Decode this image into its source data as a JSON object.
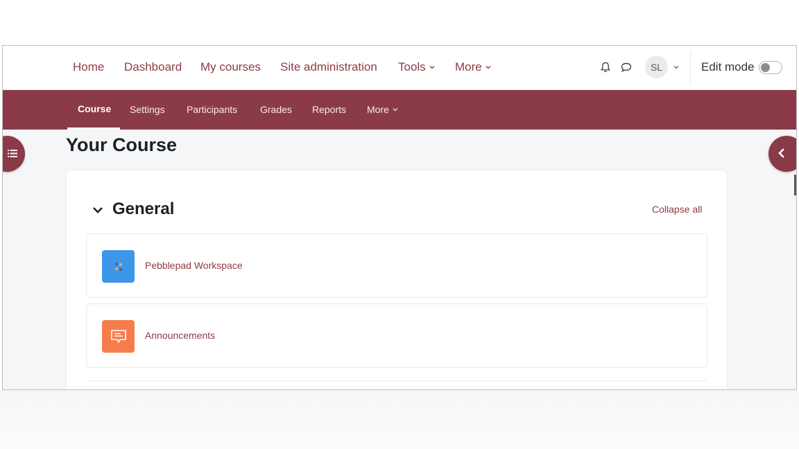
{
  "navbar": {
    "items": [
      {
        "label": "Home"
      },
      {
        "label": "Dashboard"
      },
      {
        "label": "My courses"
      },
      {
        "label": "Site administration"
      },
      {
        "label": "Tools"
      },
      {
        "label": "More"
      }
    ],
    "user_initials": "SL",
    "edit_mode_label": "Edit mode",
    "edit_mode_on": false
  },
  "course_nav": {
    "items": [
      {
        "label": "Course",
        "active": true
      },
      {
        "label": "Settings"
      },
      {
        "label": "Participants"
      },
      {
        "label": "Grades"
      },
      {
        "label": "Reports"
      },
      {
        "label": "More"
      }
    ]
  },
  "page": {
    "title": "Your Course"
  },
  "section": {
    "title": "General",
    "collapse_label": "Collapse all",
    "activities": [
      {
        "name": "Pebblepad Workspace",
        "icon": "pebblepad-icon",
        "color": "#3d97e8"
      },
      {
        "name": "Announcements",
        "icon": "forum-icon",
        "color": "#f77c4c"
      }
    ]
  },
  "colors": {
    "brand": "#8b3a48",
    "link": "#8f3b45"
  }
}
